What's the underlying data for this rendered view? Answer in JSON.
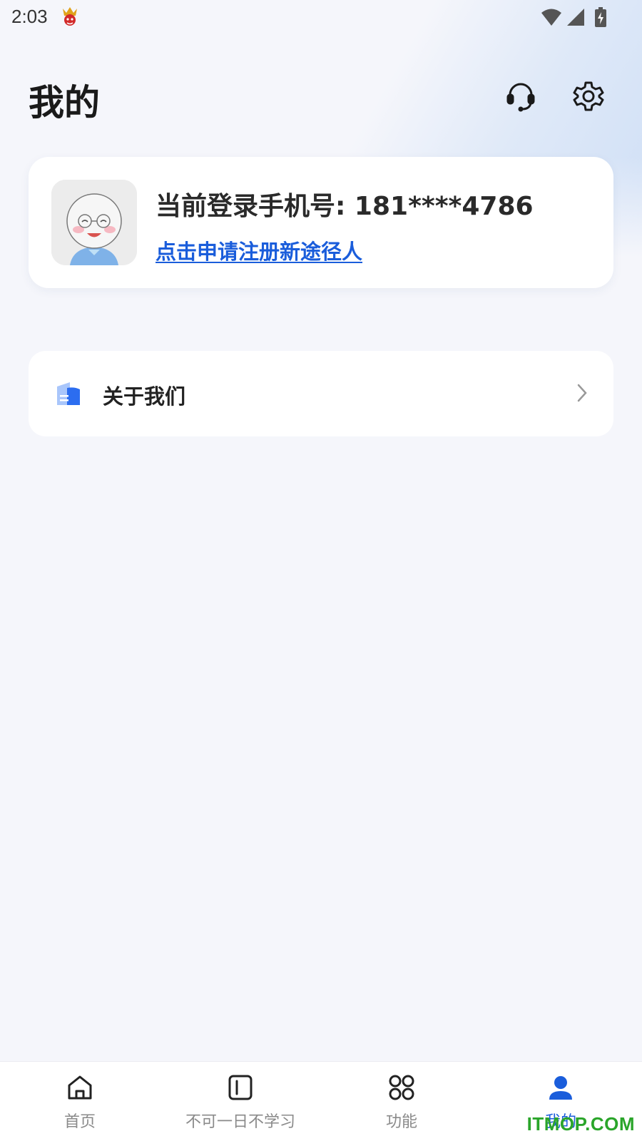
{
  "status_bar": {
    "time": "2:03",
    "icons": [
      "app-notification-icon",
      "wifi-icon",
      "signal-icon",
      "battery-charging-icon"
    ]
  },
  "header": {
    "title": "我的",
    "actions": [
      "headset-icon",
      "gear-icon"
    ]
  },
  "profile": {
    "phone_text": "当前登录手机号: 181****4786",
    "register_link": "点击申请注册新途径人"
  },
  "menu": {
    "items": [
      {
        "label": "关于我们",
        "icon": "document-folder-icon"
      }
    ]
  },
  "bottom_nav": {
    "items": [
      {
        "label": "首页",
        "icon": "home-icon",
        "active": false
      },
      {
        "label": "不可一日不学习",
        "icon": "book-icon",
        "active": false
      },
      {
        "label": "功能",
        "icon": "grid-icon",
        "active": false
      },
      {
        "label": "我的",
        "icon": "user-icon",
        "active": true
      }
    ]
  },
  "colors": {
    "accent": "#1a5ddb",
    "background": "#f5f6fb",
    "card": "#ffffff",
    "inactive": "#8a8a8a"
  },
  "watermark": "ITMOP.COM"
}
